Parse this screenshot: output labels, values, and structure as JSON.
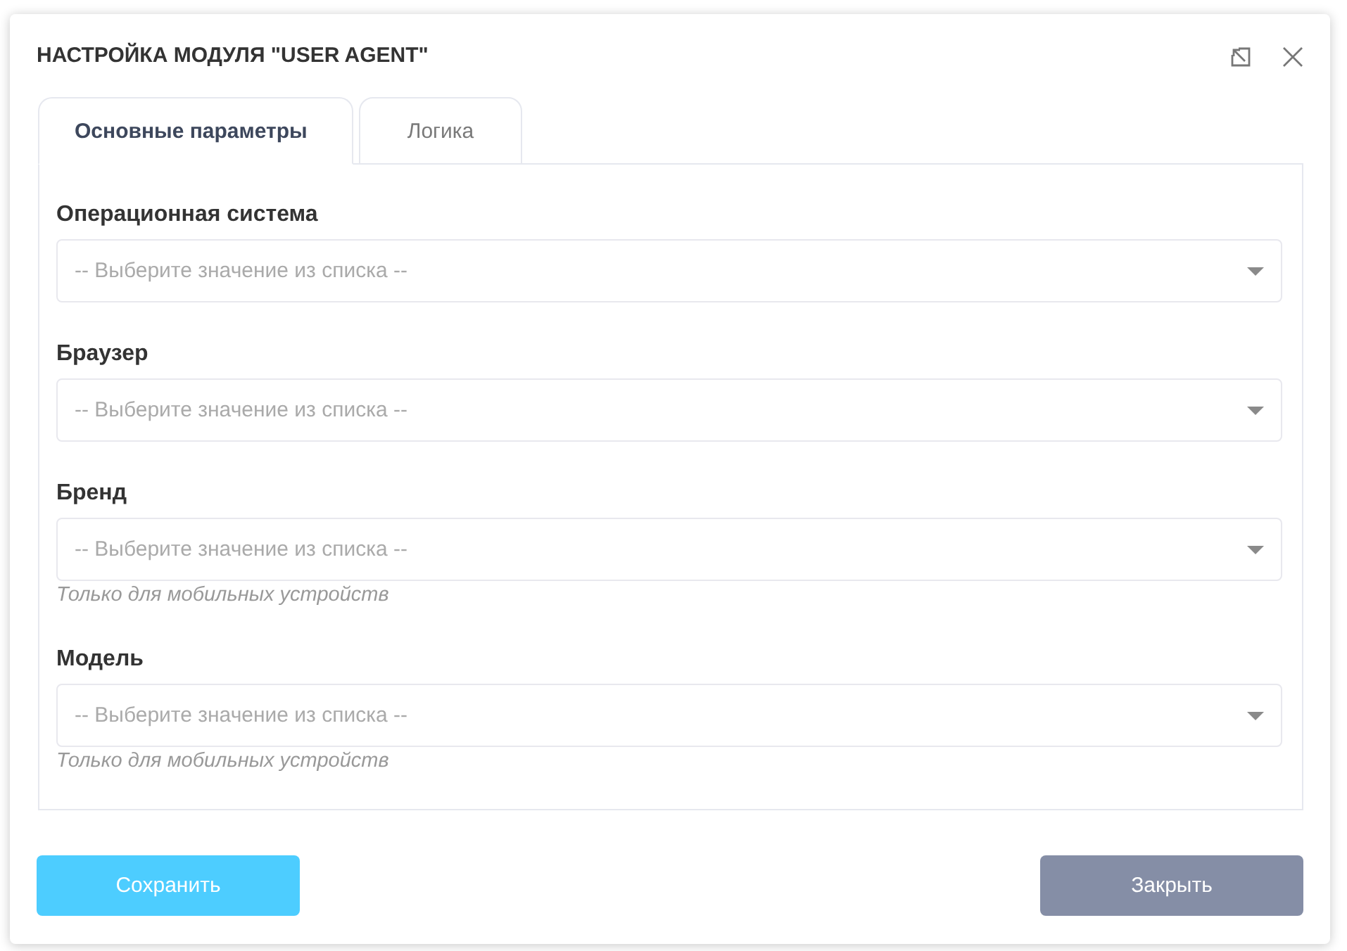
{
  "dialog": {
    "title": "НАСТРОЙКА МОДУЛЯ \"USER AGENT\""
  },
  "tabs": [
    {
      "label": "Основные параметры",
      "selected": true
    },
    {
      "label": "Логика",
      "selected": false
    }
  ],
  "fields": [
    {
      "label": "Операционная система",
      "placeholder": "-- Выберите значение из списка --"
    },
    {
      "label": "Браузер",
      "placeholder": "-- Выберите значение из списка --"
    },
    {
      "label": "Бренд",
      "placeholder": "-- Выберите значение из списка --",
      "hint": "Только для мобильных устройств"
    },
    {
      "label": "Модель",
      "placeholder": "-- Выберите значение из списка --",
      "hint": "Только для мобильных устройств"
    }
  ],
  "buttons": [
    {
      "label": "Сохранить",
      "kind": "primary"
    },
    {
      "label": "Закрыть",
      "kind": "secondary"
    }
  ]
}
